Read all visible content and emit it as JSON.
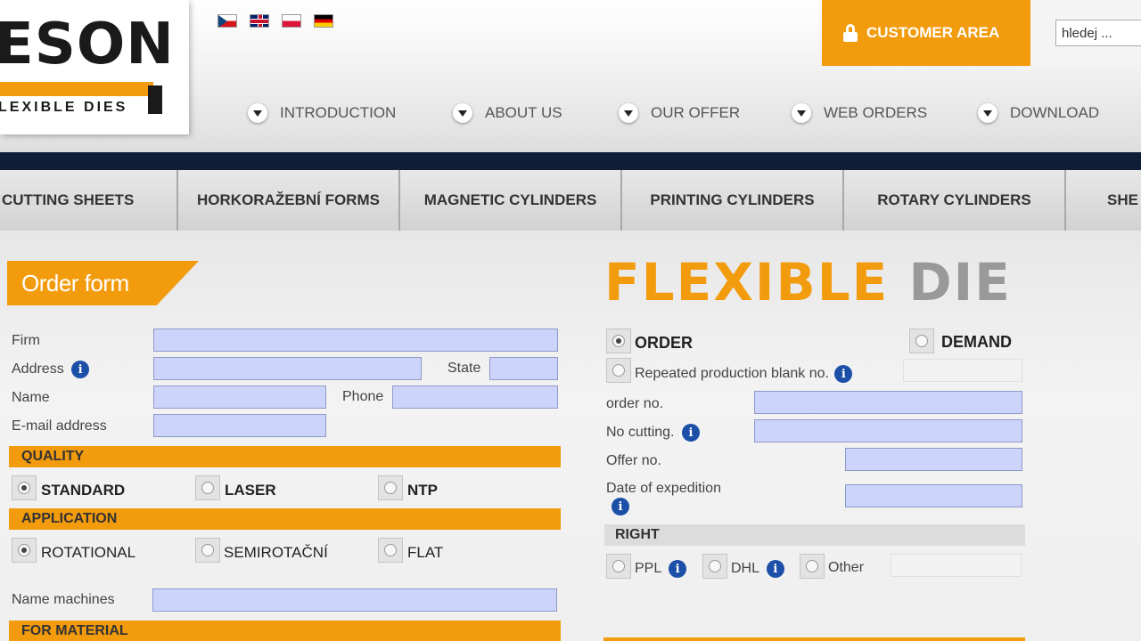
{
  "header": {
    "logo_text": "ESON",
    "logo_sub": "LEXIBLE DIES",
    "customer_area": "CUSTOMER AREA",
    "search_value": "hledej ..."
  },
  "nav": [
    "INTRODUCTION",
    "ABOUT US",
    "OUR OFFER",
    "WEB ORDERS",
    "DOWNLOAD"
  ],
  "categories": [
    "CUTTING SHEETS",
    "HORKORAŽEBNÍ FORMS",
    "MAGNETIC CYLINDERS",
    "PRINTING CYLINDERS",
    "ROTARY CYLINDERS",
    "SHE"
  ],
  "form": {
    "title": "Order form",
    "firm": "Firm",
    "address": "Address",
    "state": "State",
    "name": "Name",
    "phone": "Phone",
    "email": "E-mail address",
    "quality": "QUALITY",
    "quality_options": [
      "STANDARD",
      "LASER",
      "NTP"
    ],
    "application": "APPLICATION",
    "application_options": [
      "ROTATIONAL",
      "SEMIROTAČNÍ",
      "FLAT"
    ],
    "name_machines": "Name machines",
    "for_material": "FOR MATERIAL"
  },
  "right": {
    "title_a": "FLEXIBLE",
    "title_b": "DIE",
    "order": "ORDER",
    "demand": "DEMAND",
    "repeated": "Repeated production blank no.",
    "order_no": "order no.",
    "no_cutting": "No cutting.",
    "offer_no": "Offer no.",
    "date_expedition": "Date of expedition",
    "right_header": "RIGHT",
    "ppl": "PPL",
    "dhl": "DHL",
    "other": "Other"
  },
  "colors": {
    "accent": "#f29b0d",
    "navy": "#0f1e36",
    "field": "#ccd4fb"
  }
}
